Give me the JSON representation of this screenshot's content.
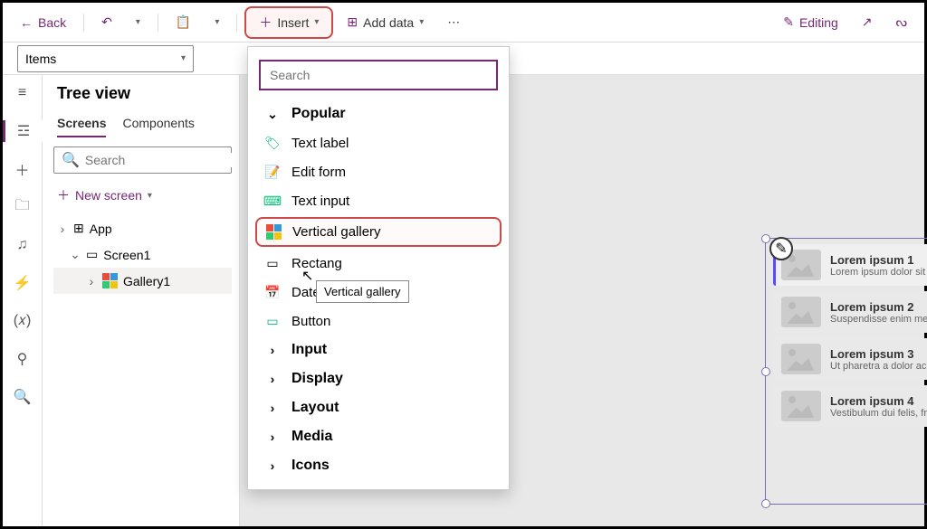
{
  "toolbar": {
    "back": "Back",
    "insert": "Insert",
    "addData": "Add data",
    "editing": "Editing"
  },
  "propSelect": "Items",
  "tree": {
    "title": "Tree view",
    "tabs": {
      "screens": "Screens",
      "components": "Components"
    },
    "searchPlaceholder": "Search",
    "newScreen": "New screen",
    "app": "App",
    "screen1": "Screen1",
    "gallery1": "Gallery1"
  },
  "dropdown": {
    "searchPlaceholder": "Search",
    "popular": "Popular",
    "textLabel": "Text label",
    "editForm": "Edit form",
    "textInput": "Text input",
    "verticalGallery": "Vertical gallery",
    "rectangle": "Rectang",
    "datePicker": "Date picker",
    "button": "Button",
    "input": "Input",
    "display": "Display",
    "layout": "Layout",
    "media": "Media",
    "icons": "Icons"
  },
  "tooltip": "Vertical gallery",
  "gallery": [
    {
      "title": "Lorem ipsum 1",
      "sub": "Lorem ipsum dolor sit amet, consectetur adipiscing elit."
    },
    {
      "title": "Lorem ipsum 2",
      "sub": "Suspendisse enim metus, tincidunt quis lobortis a, fringilla"
    },
    {
      "title": "Lorem ipsum 3",
      "sub": "Ut pharetra a dolor ac vehicula."
    },
    {
      "title": "Lorem ipsum 4",
      "sub": "Vestibulum dui felis, fringilla nec mi sed, tristique dictum nisi."
    }
  ]
}
